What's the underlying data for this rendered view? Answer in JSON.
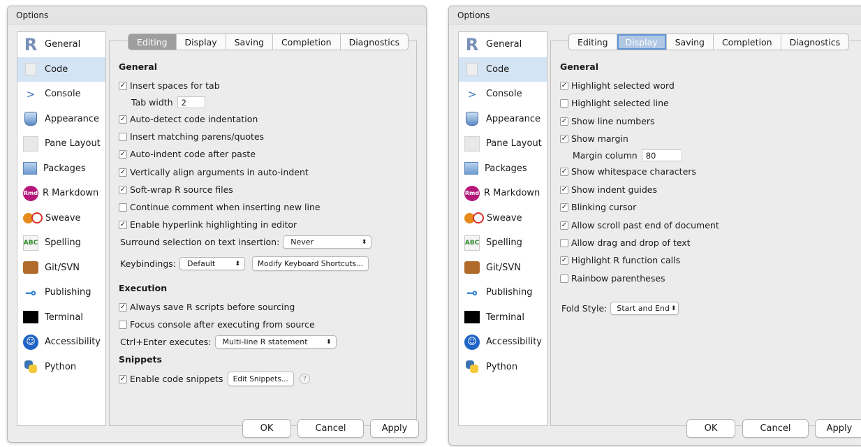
{
  "left": {
    "title": "Options",
    "sidebar": [
      {
        "label": "General",
        "icon": "r-logo-icon"
      },
      {
        "label": "Code",
        "icon": "code-icon",
        "selected": true
      },
      {
        "label": "Console",
        "icon": "console-icon"
      },
      {
        "label": "Appearance",
        "icon": "appearance-icon"
      },
      {
        "label": "Pane Layout",
        "icon": "pane-layout-icon"
      },
      {
        "label": "Packages",
        "icon": "packages-icon"
      },
      {
        "label": "R Markdown",
        "icon": "rmarkdown-icon"
      },
      {
        "label": "Sweave",
        "icon": "sweave-icon"
      },
      {
        "label": "Spelling",
        "icon": "spelling-icon"
      },
      {
        "label": "Git/SVN",
        "icon": "git-icon"
      },
      {
        "label": "Publishing",
        "icon": "publishing-icon"
      },
      {
        "label": "Terminal",
        "icon": "terminal-icon"
      },
      {
        "label": "Accessibility",
        "icon": "accessibility-icon"
      },
      {
        "label": "Python",
        "icon": "python-icon"
      }
    ],
    "tabs": [
      "Editing",
      "Display",
      "Saving",
      "Completion",
      "Diagnostics"
    ],
    "active_tab": "Editing",
    "general_title": "General",
    "insert_spaces": "Insert spaces for tab",
    "tab_width_label": "Tab width",
    "tab_width_value": "2",
    "auto_detect": "Auto-detect code indentation",
    "insert_matching": "Insert matching parens/quotes",
    "auto_indent": "Auto-indent code after paste",
    "vertically_align": "Vertically align arguments in auto-indent",
    "soft_wrap": "Soft-wrap R source files",
    "continue_comment": "Continue comment when inserting new line",
    "enable_hyperlink": "Enable hyperlink highlighting in editor",
    "surround_label": "Surround selection on text insertion:",
    "surround_value": "Never",
    "keybindings_label": "Keybindings:",
    "keybindings_value": "Default",
    "modify_shortcuts": "Modify Keyboard Shortcuts...",
    "execution_title": "Execution",
    "always_save": "Always save R scripts before sourcing",
    "focus_console": "Focus console after executing from source",
    "ctrl_enter_label": "Ctrl+Enter executes:",
    "ctrl_enter_value": "Multi-line R statement",
    "snippets_title": "Snippets",
    "enable_snippets": "Enable code snippets",
    "edit_snippets": "Edit Snippets...",
    "help_glyph": "?",
    "ok": "OK",
    "cancel": "Cancel",
    "apply": "Apply"
  },
  "right": {
    "title": "Options",
    "active_tab": "Display",
    "general_title": "General",
    "highlight_word": "Highlight selected word",
    "highlight_line": "Highlight selected line",
    "show_line_numbers": "Show line numbers",
    "show_margin": "Show margin",
    "margin_column_label": "Margin column",
    "margin_column_value": "80",
    "show_whitespace": "Show whitespace characters",
    "show_indent": "Show indent guides",
    "blinking_cursor": "Blinking cursor",
    "allow_scroll": "Allow scroll past end of document",
    "allow_drag": "Allow drag and drop of text",
    "highlight_r": "Highlight R function calls",
    "rainbow": "Rainbow parentheses",
    "fold_style_label": "Fold Style:",
    "fold_style_value": "Start and End",
    "ok": "OK",
    "cancel": "Cancel",
    "apply": "Apply"
  },
  "checkbox_glyph": "✓",
  "select_arrow": "⬍",
  "colors": {
    "selected_row": "#d4e4f4",
    "active_tab": "#9e9e9e",
    "display_tab_outline": "#5f95d8"
  }
}
